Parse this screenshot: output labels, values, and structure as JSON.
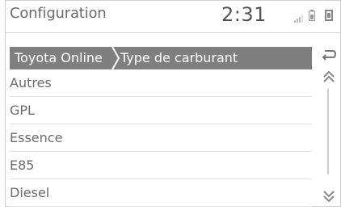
{
  "header": {
    "title": "Configuration",
    "clock": "2:31"
  },
  "breadcrumb": {
    "items": [
      "Toyota Online",
      "Type de carburant"
    ]
  },
  "list": {
    "items": [
      "Autres",
      "GPL",
      "Essence",
      "E85",
      "Diesel"
    ]
  },
  "icons": {
    "back": "back-arrow-icon",
    "scroll_up": "chevron-up-double-icon",
    "scroll_down": "chevron-down-double-icon",
    "signal": "signal-icon",
    "battery": "battery-icon"
  },
  "colors": {
    "breadcrumb_bg": "#7f7f7f",
    "text": "#6b6b6b",
    "divider": "#e2e2e2"
  }
}
